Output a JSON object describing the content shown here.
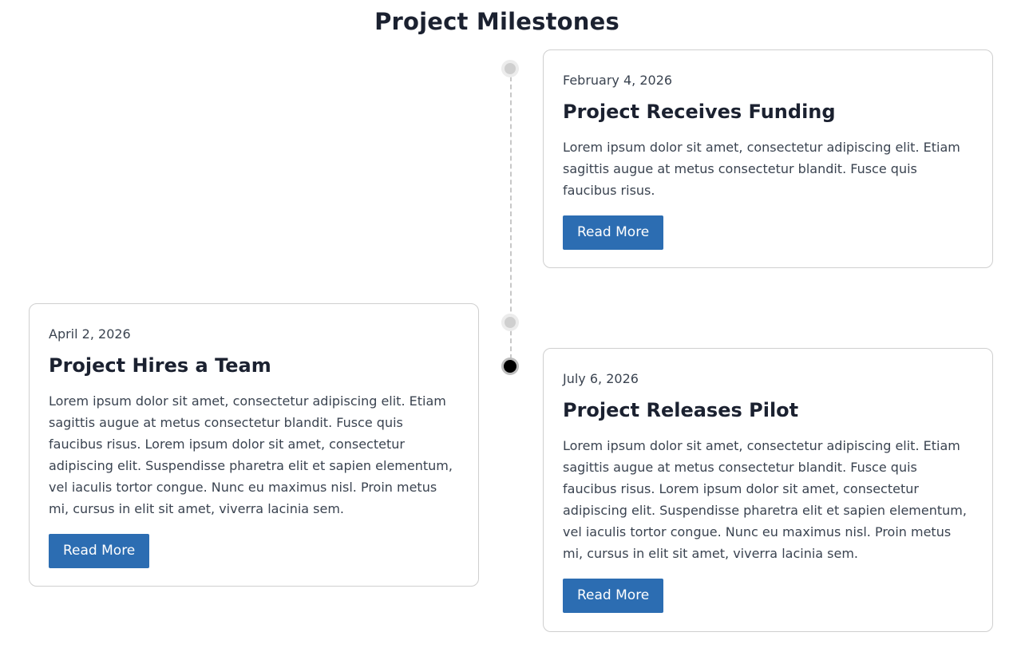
{
  "page": {
    "title": "Project Milestones"
  },
  "milestones": [
    {
      "date": "February 4, 2026",
      "title": "Project Receives Funding",
      "text": "Lorem ipsum dolor sit amet, consectetur adipiscing elit. Etiam sagittis augue at metus consectetur blandit. Fusce quis faucibus risus.",
      "button_label": "Read More"
    },
    {
      "date": "April 2, 2026",
      "title": "Project Hires a Team",
      "text": "Lorem ipsum dolor sit amet, consectetur adipiscing elit. Etiam sagittis augue at metus consectetur blandit. Fusce quis faucibus risus. Lorem ipsum dolor sit amet, consectetur adipiscing elit. Suspendisse pharetra elit et sapien elementum, vel iaculis tortor congue. Nunc eu maximus nisl. Proin metus mi, cursus in elit sit amet, viverra lacinia sem.",
      "button_label": "Read More"
    },
    {
      "date": "July 6, 2026",
      "title": "Project Releases Pilot",
      "text": "Lorem ipsum dolor sit amet, consectetur adipiscing elit. Etiam sagittis augue at metus consectetur blandit. Fusce quis faucibus risus. Lorem ipsum dolor sit amet, consectetur adipiscing elit. Suspendisse pharetra elit et sapien elementum, vel iaculis tortor congue. Nunc eu maximus nisl. Proin metus mi, cursus in elit sit amet, viverra lacinia sem.",
      "button_label": "Read More"
    }
  ],
  "colors": {
    "button": "#2c6db2",
    "active_dot": "#000000",
    "inactive_dot": "#cfcfcf"
  }
}
